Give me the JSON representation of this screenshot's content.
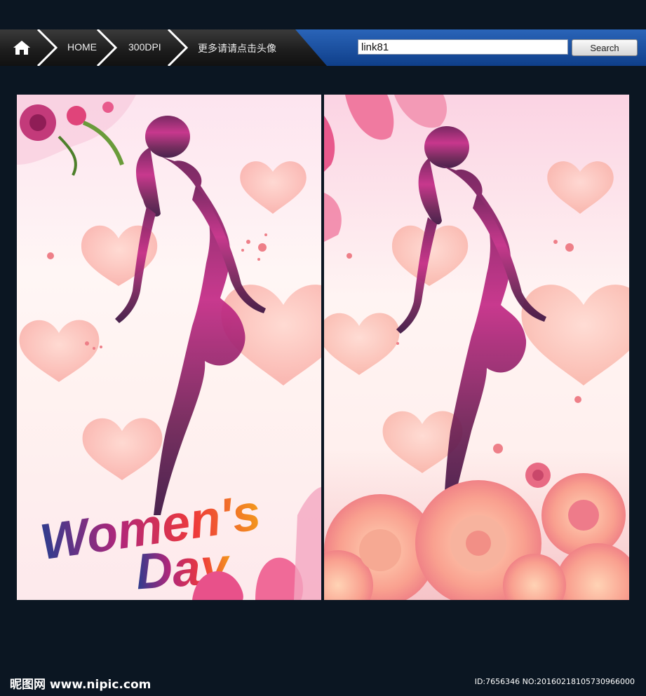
{
  "nav": {
    "home_icon": "home-icon",
    "breadcrumbs": [
      "HOME",
      "300DPI",
      "更多请请点击头像"
    ]
  },
  "search": {
    "value": "link81",
    "button_label": "Search"
  },
  "poster_left": {
    "title_line1": "Women's",
    "title_line2": "Day"
  },
  "footer": {
    "logo_text": "昵图网 www.nipic.com",
    "id_text": "ID:7656346 NO:20160218105730966000"
  },
  "colors": {
    "background": "#0b1622",
    "nav_blue": "#1a4fa0",
    "pink": "#f27aa0",
    "silhouette": "#7a1f5c"
  }
}
